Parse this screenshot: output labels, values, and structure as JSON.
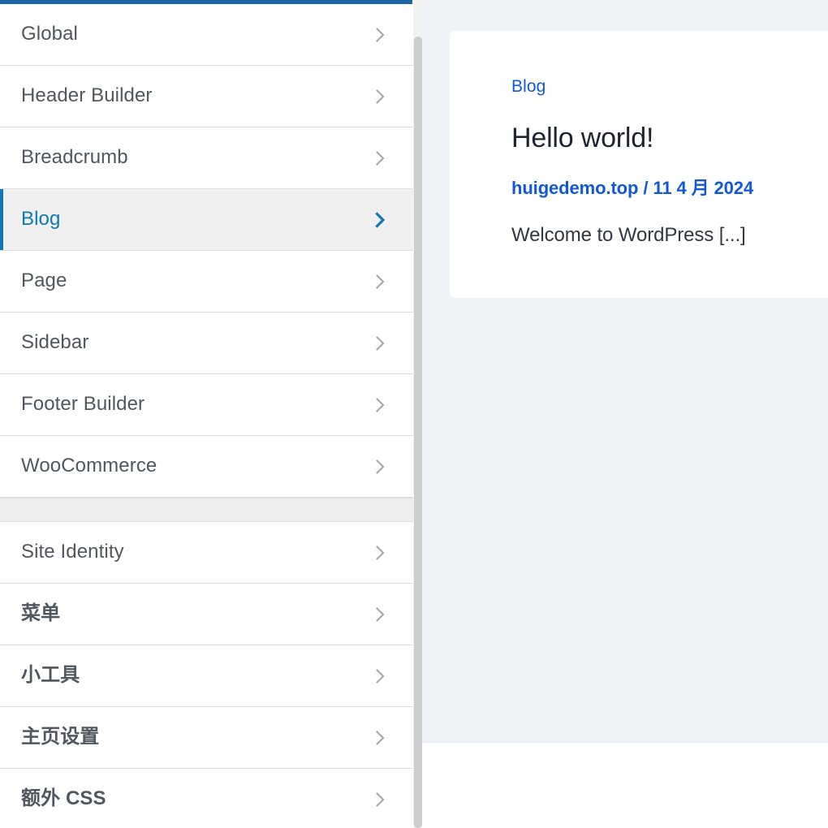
{
  "theme": {
    "accent_blue": "#1d66a5",
    "active_item_blue": "#0c7ab3",
    "link_blue": "#1159d8",
    "label_grey": "#50575e",
    "chevron_grey": "#a7aaad",
    "active_row_bg": "#f0f0f1",
    "separator_bg": "#eeeeee",
    "preview_bg": "#eff3f7",
    "card_bg": "#ffffff"
  },
  "sidebar": {
    "chevron_icon": "chevron-right-icon",
    "groups": [
      {
        "name": "theme-sections",
        "items": [
          {
            "label": "Global",
            "active": false,
            "cjk": false
          },
          {
            "label": "Header Builder",
            "active": false,
            "cjk": false
          },
          {
            "label": "Breadcrumb",
            "active": false,
            "cjk": false
          },
          {
            "label": "Blog",
            "active": true,
            "cjk": false
          },
          {
            "label": "Page",
            "active": false,
            "cjk": false
          },
          {
            "label": "Sidebar",
            "active": false,
            "cjk": false
          },
          {
            "label": "Footer Builder",
            "active": false,
            "cjk": false
          },
          {
            "label": "WooCommerce",
            "active": false,
            "cjk": false
          }
        ]
      },
      {
        "name": "wordpress-core-sections",
        "items": [
          {
            "label": "Site Identity",
            "active": false,
            "cjk": false
          },
          {
            "label": "菜单",
            "active": false,
            "cjk": true
          },
          {
            "label": "小工具",
            "active": false,
            "cjk": true
          },
          {
            "label": "主页设置",
            "active": false,
            "cjk": true
          },
          {
            "label": "额外 CSS",
            "active": false,
            "cjk": true
          }
        ]
      }
    ],
    "scrollbar": {
      "name": "sidebar-scrollbar"
    }
  },
  "preview": {
    "post_card": {
      "category": "Blog",
      "title": "Hello world!",
      "meta_site": "huigedemo.top",
      "meta_separator": "/",
      "meta_date": "11 4 月 2024",
      "excerpt": "Welcome to WordPress [...]"
    }
  }
}
